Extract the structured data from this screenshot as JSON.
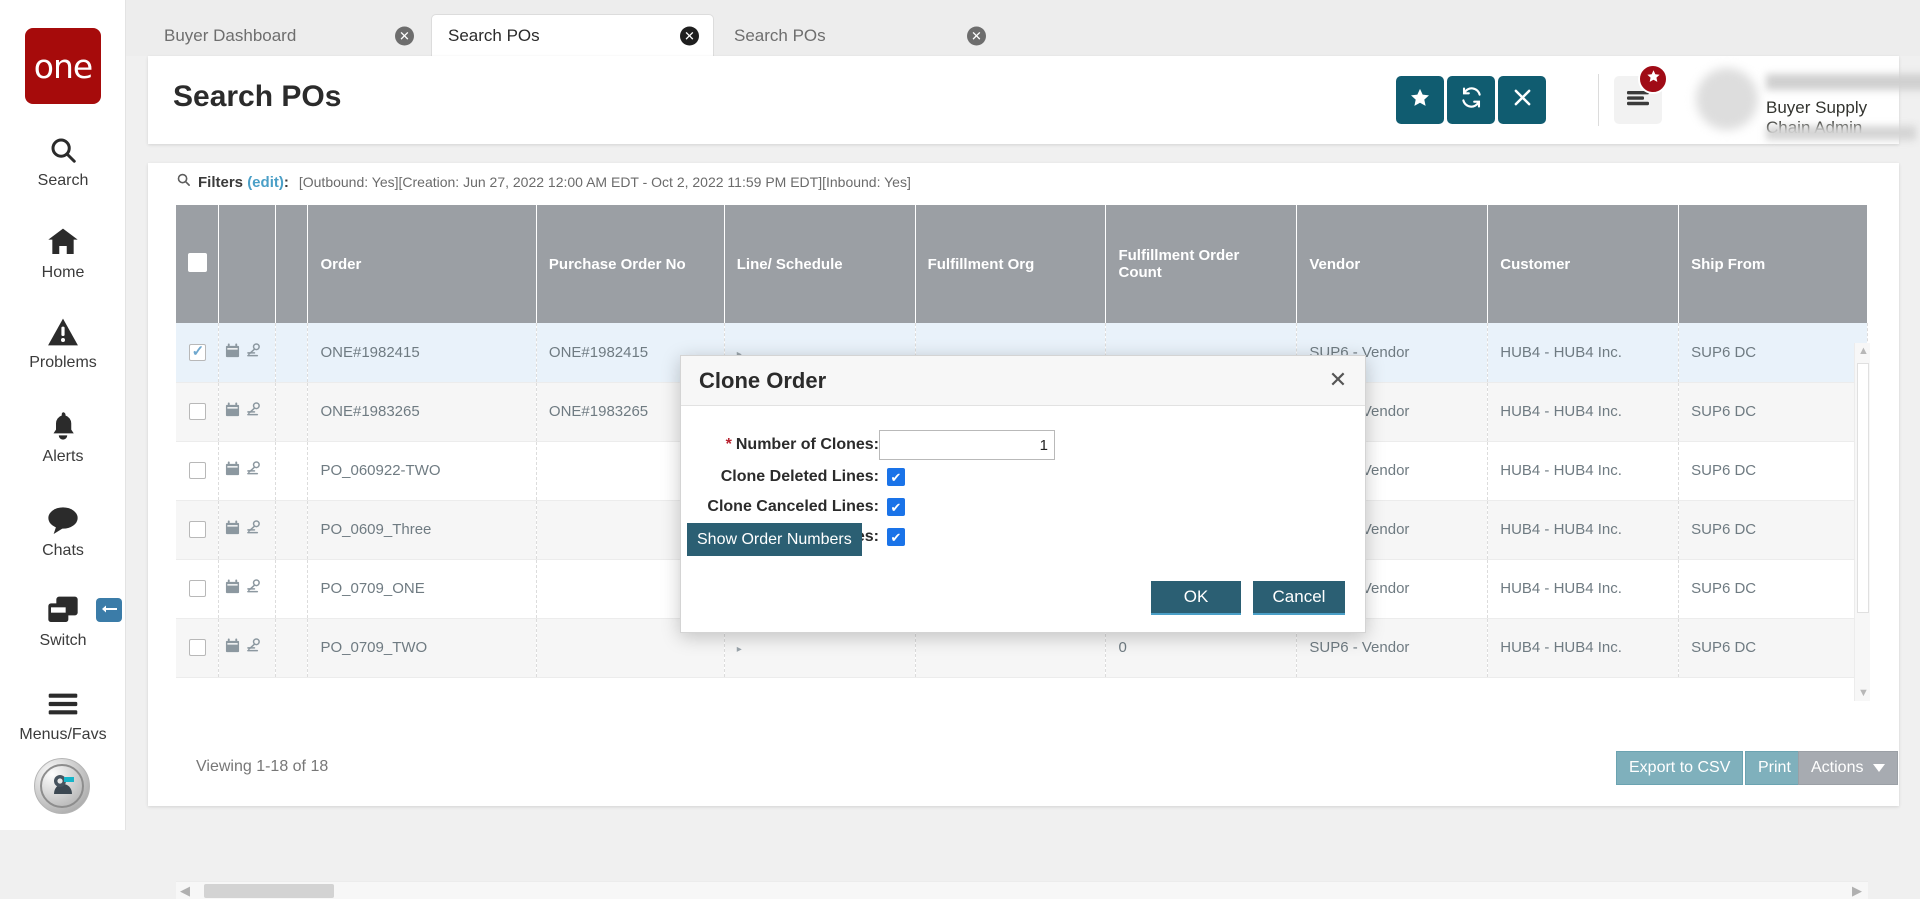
{
  "sidebar": {
    "logo_text": "one",
    "items": [
      {
        "label": "Search",
        "icon": "search-icon"
      },
      {
        "label": "Home",
        "icon": "home-icon"
      },
      {
        "label": "Problems",
        "icon": "warning-triangle-icon"
      },
      {
        "label": "Alerts",
        "icon": "bell-icon"
      },
      {
        "label": "Chats",
        "icon": "chat-bubble-icon"
      },
      {
        "label": "Switch",
        "icon": "switch-windows-icon"
      },
      {
        "label": "Menus/Favs",
        "icon": "hamburger-icon"
      }
    ],
    "switch_badge_icon": "arrows-swap-icon",
    "bot_avatar_icon": "robot-avatar-icon"
  },
  "tabs": [
    {
      "label": "Buyer Dashboard",
      "active": false
    },
    {
      "label": "Search POs",
      "active": true
    },
    {
      "label": "Search POs",
      "active": false
    }
  ],
  "header": {
    "title": "Search POs",
    "buttons": [
      {
        "name": "favorite-button",
        "icon": "star-icon"
      },
      {
        "name": "refresh-button",
        "icon": "refresh-icon"
      },
      {
        "name": "close-button",
        "icon": "x-icon"
      }
    ],
    "menu_icon": "hamburger-menu-icon",
    "menu_badge_icon": "star-icon",
    "user_role": "Buyer Supply Chain Admin",
    "caret_icon": "chevron-down-icon"
  },
  "filters": {
    "icon": "search-icon",
    "label": "Filters",
    "edit_label": "(edit)",
    "colon": ":",
    "value": "[Outbound: Yes][Creation: Jun 27, 2022 12:00 AM EDT - Oct 2, 2022 11:59 PM EDT][Inbound: Yes]"
  },
  "table": {
    "columns": [
      "",
      "",
      "",
      "Order",
      "Purchase Order No",
      "Line/ Schedule",
      "Fulfillment Org",
      "Fulfillment Order Count",
      "Vendor",
      "Customer",
      "Ship From"
    ],
    "rows": [
      {
        "selected": true,
        "order": "ONE#1982415",
        "po_no": "ONE#1982415",
        "line": "",
        "ful_org": "",
        "ful_count": "",
        "vendor": "SUP6 - Vendor",
        "customer": "HUB4 - HUB4 Inc.",
        "ship_from": "SUP6 DC"
      },
      {
        "selected": false,
        "order": "ONE#1983265",
        "po_no": "ONE#1983265",
        "line": "",
        "ful_org": "",
        "ful_count": "",
        "vendor": "SUP6 - Vendor",
        "customer": "HUB4 - HUB4 Inc.",
        "ship_from": "SUP6 DC"
      },
      {
        "selected": false,
        "order": "PO_060922-TWO",
        "po_no": "",
        "line": "",
        "ful_org": "",
        "ful_count": "",
        "vendor": "SUP6 - Vendor",
        "customer": "HUB4 - HUB4 Inc.",
        "ship_from": "SUP6 DC"
      },
      {
        "selected": false,
        "order": "PO_0609_Three",
        "po_no": "",
        "line": "",
        "ful_org": "",
        "ful_count": "",
        "vendor": "SUP6 - Vendor",
        "customer": "HUB4 - HUB4 Inc.",
        "ship_from": "SUP6 DC"
      },
      {
        "selected": false,
        "order": "PO_0709_ONE",
        "po_no": "",
        "line": "",
        "ful_org": "",
        "ful_count": "",
        "vendor": "SUP6 - Vendor",
        "customer": "HUB4 - HUB4 Inc.",
        "ship_from": "SUP6 DC"
      },
      {
        "selected": false,
        "order": "PO_0709_TWO",
        "po_no": "",
        "line": "",
        "ful_org": "",
        "ful_count": "0",
        "vendor": "SUP6 - Vendor",
        "customer": "HUB4 - HUB4 Inc.",
        "ship_from": "SUP6 DC"
      }
    ],
    "row_icon_calendar": "calendar-icon",
    "row_icon_map": "map-pin-icon"
  },
  "footer": {
    "viewing": "Viewing 1-18 of 18",
    "export_label": "Export to CSV",
    "print_label": "Print",
    "actions_label": "Actions",
    "actions_caret_icon": "caret-down-icon"
  },
  "modal": {
    "title": "Clone Order",
    "close_icon": "x-icon",
    "number_of_clones_label": "Number of Clones:",
    "number_of_clones_value": "1",
    "clone_deleted_label": "Clone Deleted Lines:",
    "clone_canceled_label": "Clone Canceled Lines:",
    "clone_closed_label": "Clone Closed Lines:",
    "show_order_numbers_label": "Show Order Numbers",
    "ok_label": "OK",
    "cancel_label": "Cancel"
  },
  "colors": {
    "brand_red": "#a60b0b",
    "teal": "#105c70",
    "accent_blue": "#4a9fc7",
    "header_gray": "#9b9fa4",
    "footer_btn": "#7fb0bc",
    "checkbox_blue": "#1a73e8"
  }
}
